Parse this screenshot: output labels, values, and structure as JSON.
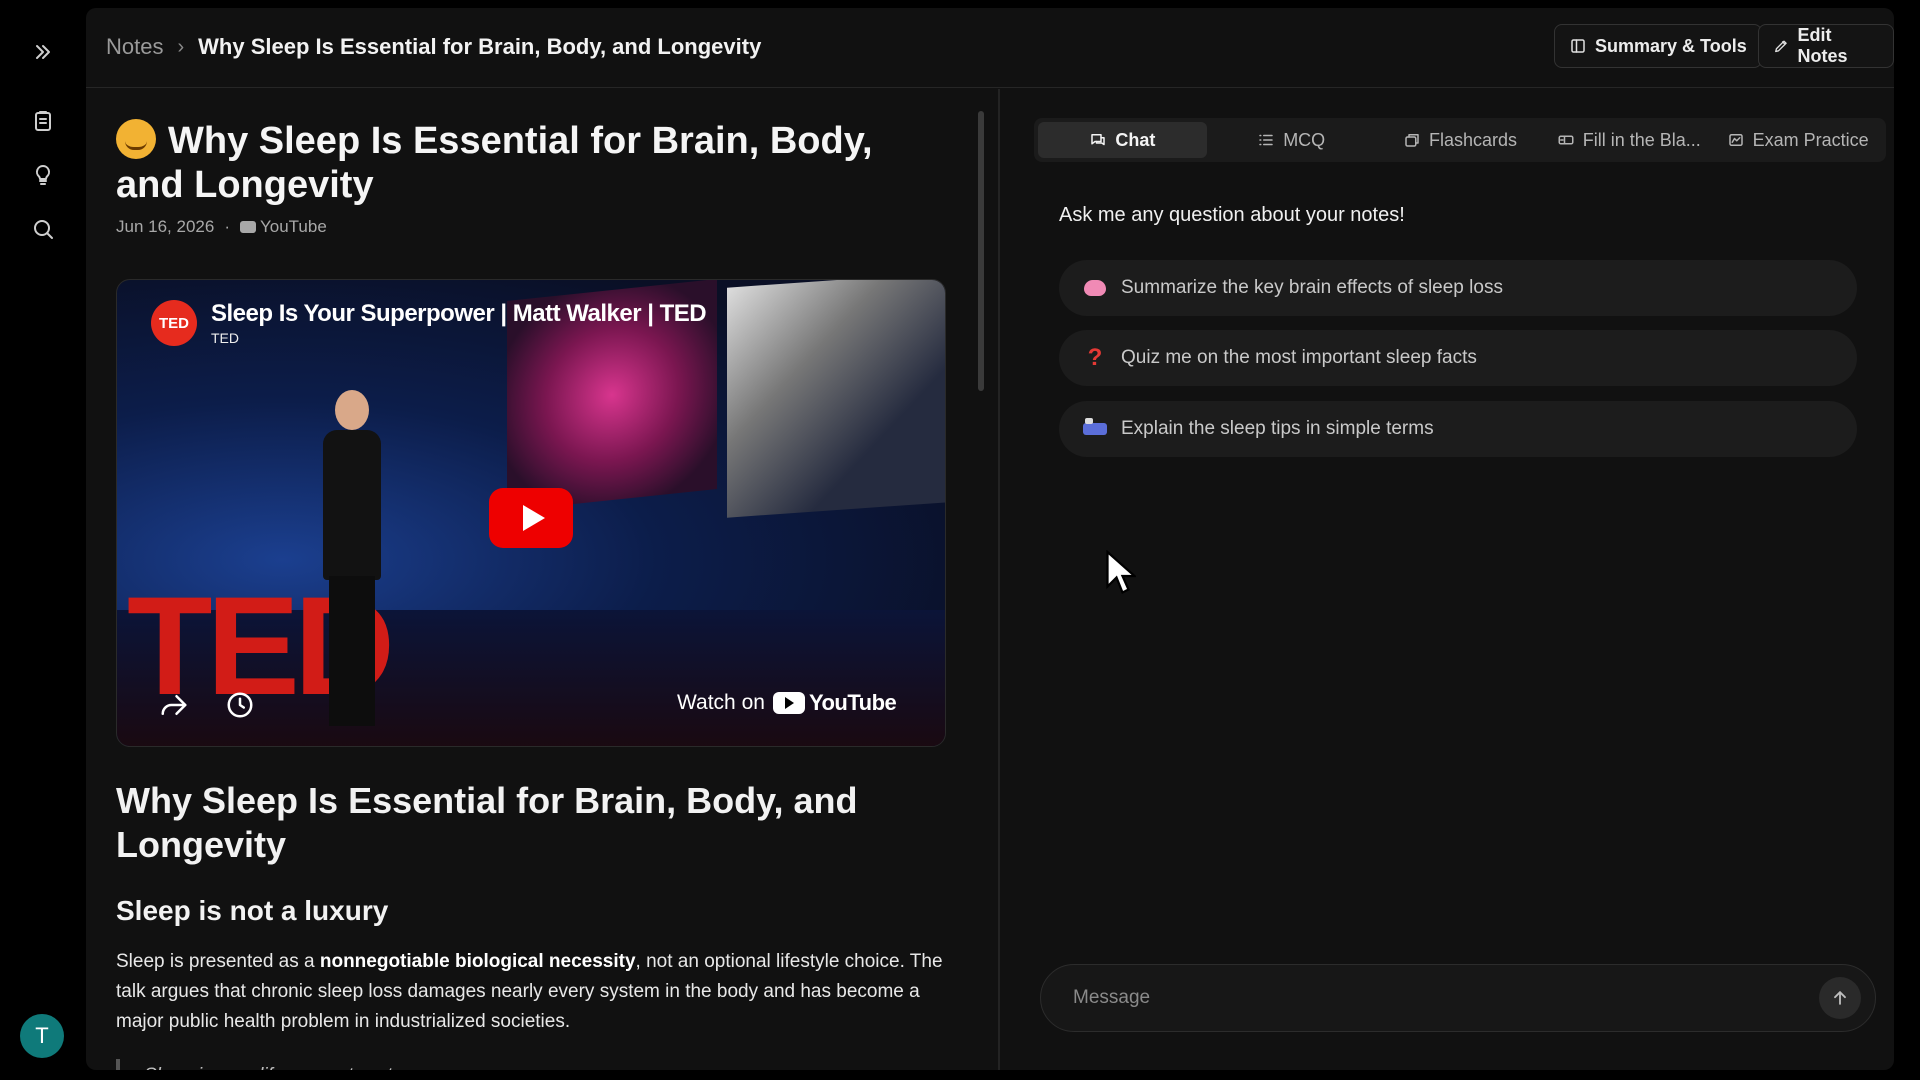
{
  "breadcrumb": {
    "root": "Notes",
    "separator": "›",
    "current": "Why Sleep Is Essential for Brain, Body, and Longevity"
  },
  "toolbar": {
    "summary_tools_label": "Summary & Tools",
    "edit_notes_label": "Edit Notes"
  },
  "sidebar": {
    "icons": [
      "expand-icon",
      "notes-icon",
      "lightbulb-icon",
      "search-icon"
    ],
    "avatar_initial": "T",
    "avatar_color": "#0f7a7a"
  },
  "note": {
    "title": "Why Sleep Is Essential for Brain, Body, and Longevity",
    "date": "Jun 16, 2026",
    "meta_sep": "·",
    "source": "YouTube",
    "video": {
      "title": "Sleep Is Your Superpower | Matt Walker | TED",
      "channel": "TED",
      "channel_logo_text": "TED",
      "watch_on": "Watch on",
      "youtube_brand": "YouTube",
      "stage_text": "TED"
    },
    "heading1": "Why Sleep Is Essential for Brain, Body, and Longevity",
    "heading2": "Sleep is not a luxury",
    "paragraph": {
      "before": "Sleep is presented as a ",
      "bold": "nonnegotiable biological necessity",
      "after": ", not an optional lifestyle choice. The talk argues that chronic sleep loss damages nearly every system in the body and has become a major public health problem in industrialized societies."
    },
    "quote": "Sleep is your life-support system"
  },
  "chat_panel": {
    "tabs": [
      {
        "label": "Chat",
        "icon": "chat-icon",
        "active": true
      },
      {
        "label": "MCQ",
        "icon": "list-icon",
        "active": false
      },
      {
        "label": "Flashcards",
        "icon": "cards-icon",
        "active": false
      },
      {
        "label": "Fill in the Bla...",
        "icon": "fill-blank-icon",
        "active": false
      },
      {
        "label": "Exam Practice",
        "icon": "exam-icon",
        "active": false
      }
    ],
    "prompt": "Ask me any question about your notes!",
    "suggestions": [
      {
        "label": "Summarize the key brain effects of sleep loss",
        "icon": "brain-icon"
      },
      {
        "label": "Quiz me on the most important sleep facts",
        "icon": "question-icon"
      },
      {
        "label": "Explain the sleep tips in simple terms",
        "icon": "bed-icon"
      }
    ],
    "message_placeholder": "Message"
  },
  "colors": {
    "background": "#000000",
    "panel": "#111111",
    "accent_red": "#ee0000",
    "ted_red": "#e62b1e"
  }
}
